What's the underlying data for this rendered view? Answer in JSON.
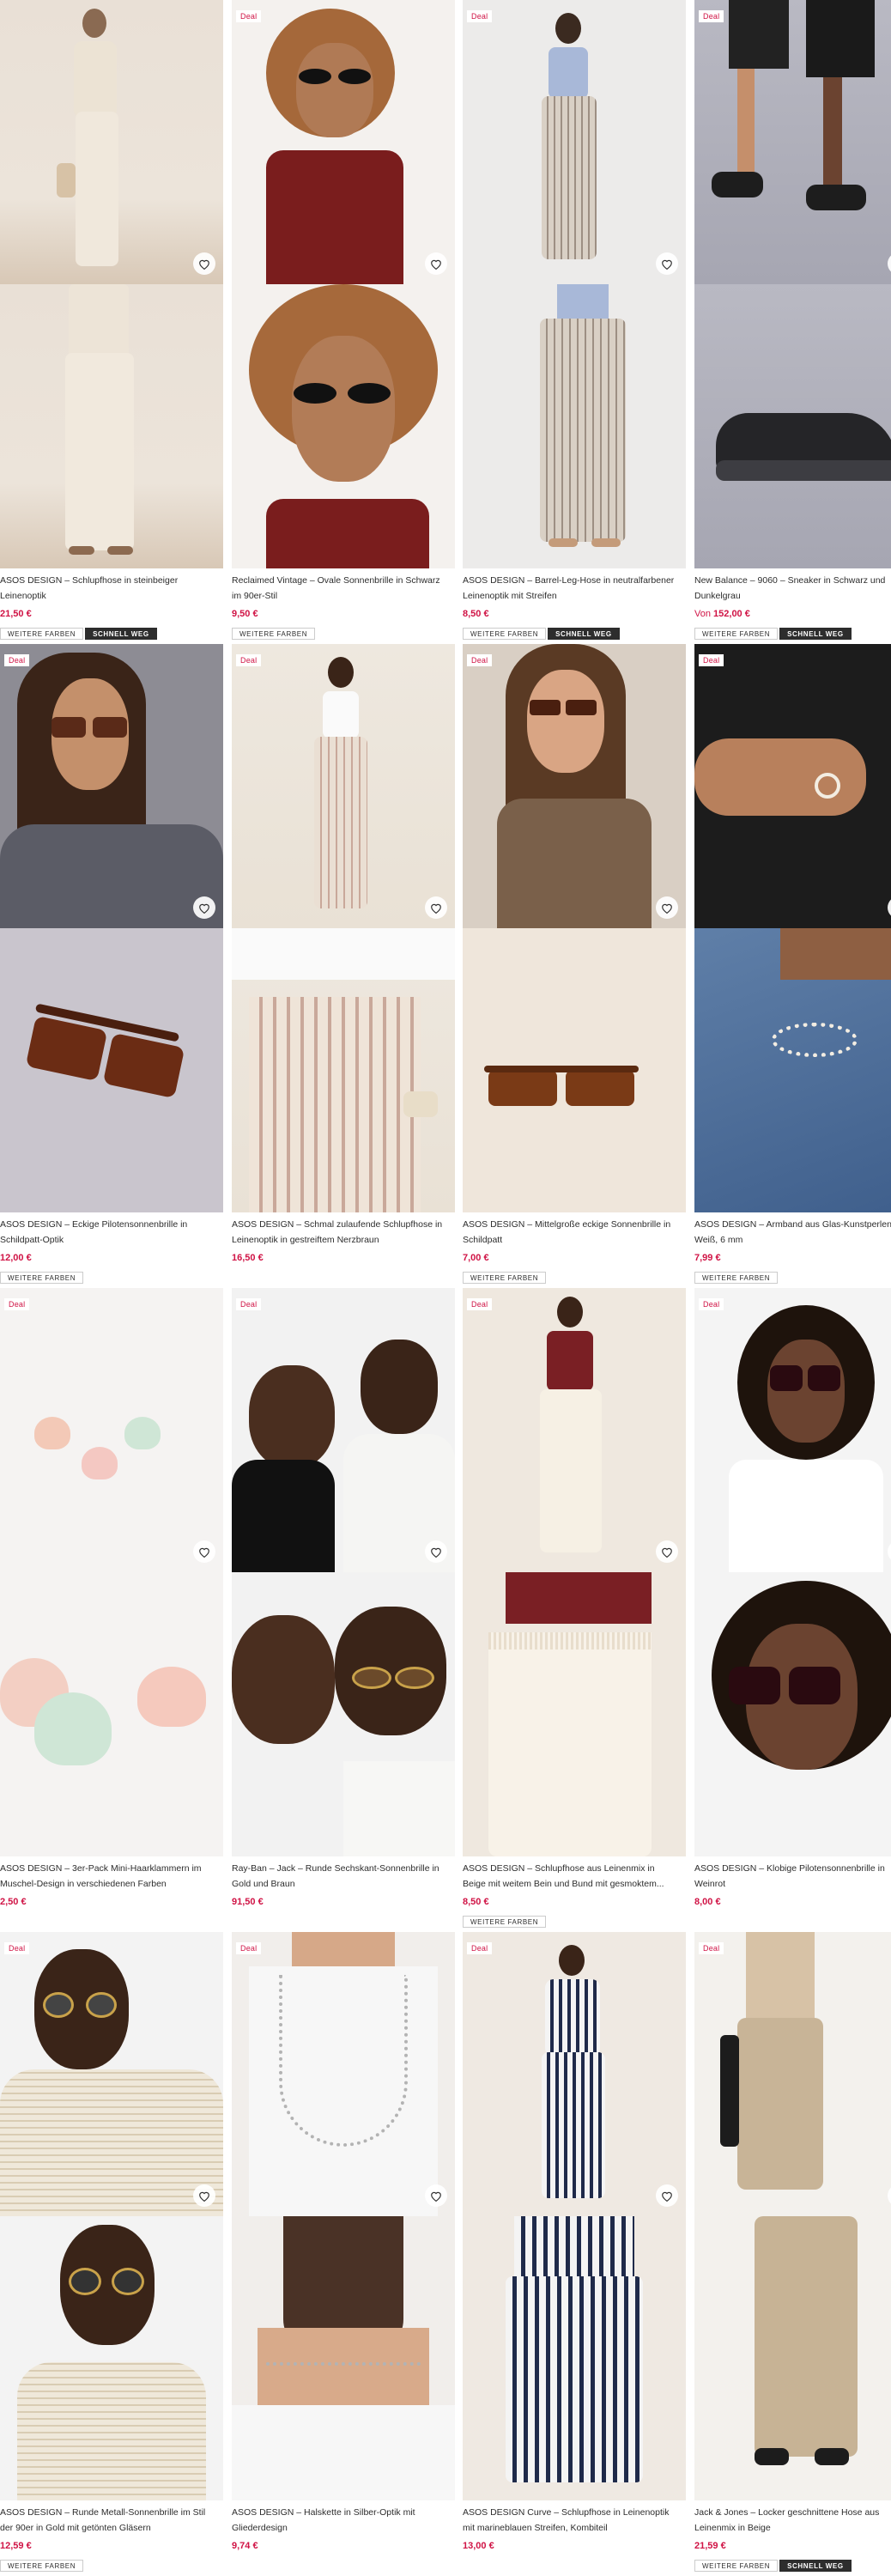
{
  "labels": {
    "more_colours": "WEITERE FARBEN",
    "selling_fast": "SCHNELL WEG",
    "deal": "Deal"
  },
  "colors": {
    "price": "#d01345",
    "text": "#2d2d2d"
  },
  "products": [
    {
      "title": "ASOS DESIGN – Schlupfhose in steinbeiger\nLeinenoptik",
      "price": "21,50 €",
      "deal": false,
      "badges": [
        "WEITERE FARBEN",
        "SCHNELL WEG"
      ],
      "icon": "heart-icon"
    },
    {
      "title": "Reclaimed Vintage – Ovale Sonnenbrille in Schwarz\nim 90er-Stil",
      "price": "9,50 €",
      "deal": true,
      "badges": [
        "WEITERE FARBEN"
      ],
      "icon": "heart-icon"
    },
    {
      "title": "ASOS DESIGN – Barrel-Leg-Hose in neutralfarbener\nLeinenoptik mit Streifen",
      "price": "8,50 €",
      "deal": true,
      "badges": [
        "WEITERE FARBEN",
        "SCHNELL WEG"
      ],
      "icon": "heart-icon"
    },
    {
      "title": "New Balance – 9060 – Sneaker in Schwarz und\nDunkelgrau",
      "price_prefix": "Von",
      "price": "152,00 €",
      "deal": true,
      "badges": [
        "WEITERE FARBEN",
        "SCHNELL WEG"
      ],
      "icon": "heart-icon"
    },
    {
      "title": "ASOS DESIGN – Eckige Pilotensonnenbrille in\nSchildpatt-Optik",
      "price": "12,00 €",
      "deal": true,
      "badges": [
        "WEITERE FARBEN"
      ],
      "icon": "heart-icon"
    },
    {
      "title": "ASOS DESIGN – Schmal zulaufende Schlupfhose in\nLeinenoptik in gestreiftem Nerzbraun",
      "price": "16,50 €",
      "deal": true,
      "badges": [],
      "icon": "heart-icon"
    },
    {
      "title": "ASOS DESIGN – Mittelgroße eckige Sonnenbrille in\nSchildpatt",
      "price": "7,00 €",
      "deal": true,
      "badges": [
        "WEITERE FARBEN"
      ],
      "icon": "heart-icon"
    },
    {
      "title": "ASOS DESIGN – Armband aus Glas-Kunstperlen in\nWeiß, 6 mm",
      "price": "7,99 €",
      "deal": true,
      "badges": [
        "WEITERE FARBEN"
      ],
      "icon": "heart-icon"
    },
    {
      "title": "ASOS DESIGN – 3er-Pack Mini-Haarklammern im\nMuschel-Design in verschiedenen Farben",
      "price": "2,50 €",
      "deal": true,
      "badges": [],
      "icon": "heart-icon"
    },
    {
      "title": "Ray-Ban – Jack – Runde Sechskant-Sonnenbrille in\nGold und Braun",
      "price": "91,50 €",
      "deal": true,
      "badges": [],
      "icon": "heart-icon"
    },
    {
      "title": "ASOS DESIGN – Schlupfhose aus Leinenmix in\nBeige mit weitem Bein und Bund mit gesmoktem...",
      "price": "8,50 €",
      "deal": true,
      "badges": [
        "WEITERE FARBEN"
      ],
      "icon": "heart-icon"
    },
    {
      "title": "ASOS DESIGN – Klobige Pilotensonnenbrille in\nWeinrot",
      "price": "8,00 €",
      "deal": true,
      "badges": [],
      "icon": "heart-icon"
    },
    {
      "title": "ASOS DESIGN – Runde Metall-Sonnenbrille im Stil\nder 90er in Gold mit getönten Gläsern",
      "price": "12,59 €",
      "deal": true,
      "badges": [
        "WEITERE FARBEN"
      ],
      "icon": "heart-icon"
    },
    {
      "title": "ASOS DESIGN – Halskette in Silber-Optik mit\nGliederdesign",
      "price": "9,74 €",
      "deal": true,
      "badges": [],
      "icon": "heart-icon"
    },
    {
      "title": "ASOS DESIGN Curve – Schlupfhose in Leinenoptik\nmit marineblauen Streifen, Kombiteil",
      "price": "13,00 €",
      "deal": true,
      "badges": [],
      "icon": "heart-icon"
    },
    {
      "title": "Jack & Jones – Locker geschnittene Hose aus\nLeinenmix in Beige",
      "price": "21,59 €",
      "deal": true,
      "badges": [
        "WEITERE FARBEN",
        "SCHNELL WEG"
      ],
      "icon": "heart-icon"
    }
  ]
}
